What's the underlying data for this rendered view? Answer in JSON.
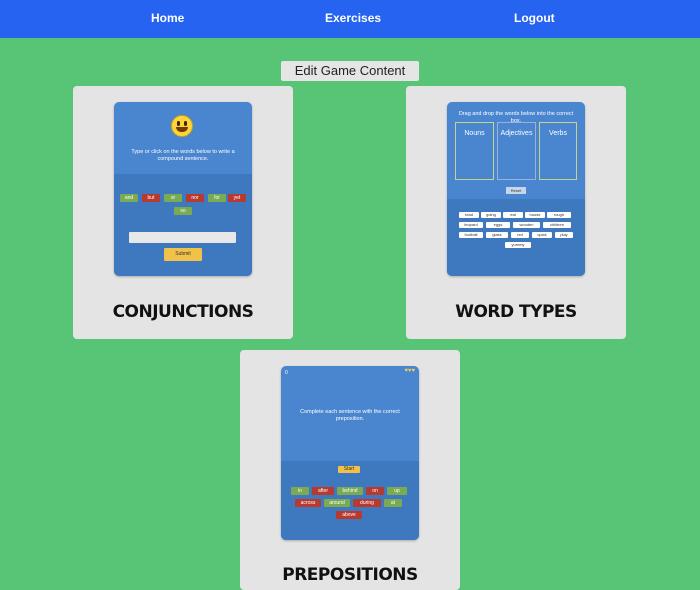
{
  "navbar": {
    "items": [
      {
        "label": "Home"
      },
      {
        "label": "Exercises"
      },
      {
        "label": "Logout"
      }
    ]
  },
  "edit_button": {
    "label": "Edit Game Content"
  },
  "cards": {
    "conjunctions": {
      "title": "CONJUNCTIONS",
      "instructions": "Type or click on the words below to write a compound sentence.",
      "words": [
        "and",
        "but",
        "or",
        "nor",
        "for",
        "yet",
        "so"
      ],
      "submit_label": "Submit"
    },
    "word_types": {
      "title": "WORD TYPES",
      "instructions": "Drag and drop the words below into the correct box.",
      "boxes": [
        "Nouns",
        "Adjectives",
        "Verbs"
      ],
      "reset_label": "Reset",
      "words": [
        "read",
        "going",
        "eat",
        "house",
        "rough",
        "leopard",
        "eggs",
        "wooden",
        "children",
        "football",
        "glass",
        "red",
        "quick",
        "play",
        "yummy"
      ]
    },
    "prepositions": {
      "title": "PREPOSITIONS",
      "score": "0",
      "hearts": "♥♥♥",
      "instructions": "Complete each sentence with the correct preposition.",
      "start_label": "Start",
      "words": [
        "in",
        "after",
        "behind",
        "on",
        "up",
        "across",
        "around",
        "during",
        "at",
        "above"
      ]
    }
  },
  "colors": {
    "background": "#57c476",
    "navbar": "#2563f0",
    "card": "#e4e4e4",
    "preview": "#4a86cf"
  }
}
